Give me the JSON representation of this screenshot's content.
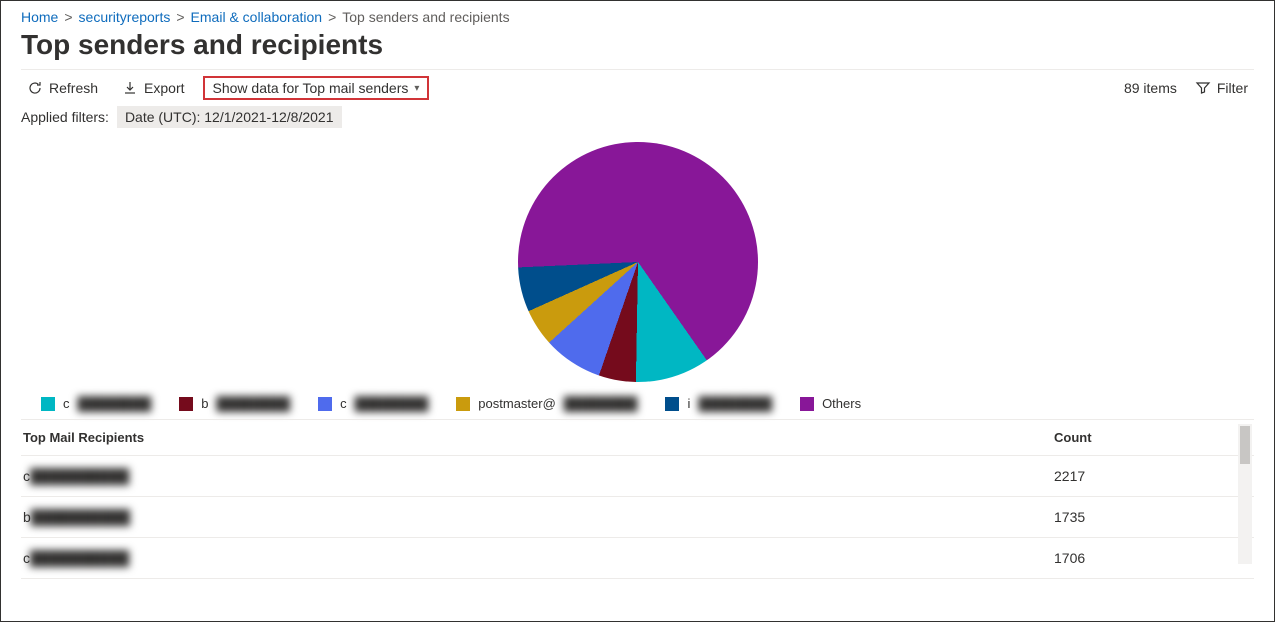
{
  "breadcrumb": {
    "items": [
      {
        "label": "Home",
        "link": true
      },
      {
        "label": "securityreports",
        "link": true
      },
      {
        "label": "Email & collaboration",
        "link": true
      },
      {
        "label": "Top senders and recipients",
        "link": false
      }
    ]
  },
  "page_title": "Top senders and recipients",
  "toolbar": {
    "refresh": "Refresh",
    "export": "Export",
    "dropdown_label": "Show data for Top mail senders",
    "items_count": "89 items",
    "filter": "Filter"
  },
  "applied_filters": {
    "label": "Applied filters:",
    "chip": "Date (UTC): 12/1/2021-12/8/2021"
  },
  "chart_data": {
    "type": "pie",
    "title": "",
    "series": [
      {
        "name": "c",
        "value": 10,
        "color": "#00b7c3"
      },
      {
        "name": "b",
        "value": 5,
        "color": "#750b1c"
      },
      {
        "name": "c",
        "value": 8,
        "color": "#4f6bed"
      },
      {
        "name": "postmaster@",
        "value": 5,
        "color": "#ca9b0d"
      },
      {
        "name": "i",
        "value": 6,
        "color": "#004e8c"
      },
      {
        "name": "Others",
        "value": 66,
        "color": "#881798"
      }
    ],
    "legend_position": "bottom"
  },
  "table": {
    "columns": {
      "name": "Top Mail Recipients",
      "count": "Count"
    },
    "rows": [
      {
        "name": "c",
        "count": "2217"
      },
      {
        "name": "b",
        "count": "1735"
      },
      {
        "name": "c",
        "count": "1706"
      }
    ]
  }
}
